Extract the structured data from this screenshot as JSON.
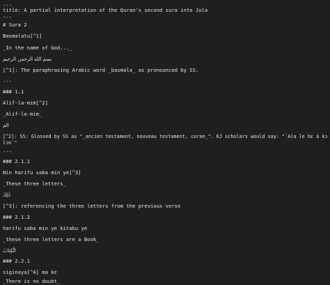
{
  "document": {
    "lines": [
      "---",
      "title: A partial interpretation of the Quran's second sura into Jula",
      "---",
      "# Sura 2",
      "Basmalatu[^1]",
      "_In the name of God..._",
      "بسم الله الرحمن الرحيم",
      "[^1]: The paraphrasing Arabic word _basmala_ as pronounced by SS.",
      "---",
      "### 1.1",
      "Alif-la-mim[^2]",
      "_Alif-la-mim_",
      "الم",
      "[^2]: SS: Glossed by SS as \"_ancien testament, nouveau testament, coran_\". KJ scholars would say: \"`Ala le bɛ à kɔrɔ",
      "lɔn`\"",
      "---",
      "### 2.1.1",
      "Nin harifu saba min ye[^3]",
      "_These three letters_",
      "ذٰلِكَ",
      "[^3]: referencing the three letters from the previous verse",
      "### 2.1.2",
      "harifu saba min ye kitabu ye",
      "_these three letters are a Book_",
      "الْكِتَابُ",
      "### 2.2.1",
      "siginaya[^4] ma kɛ",
      "_There is no doubt_"
    ]
  }
}
